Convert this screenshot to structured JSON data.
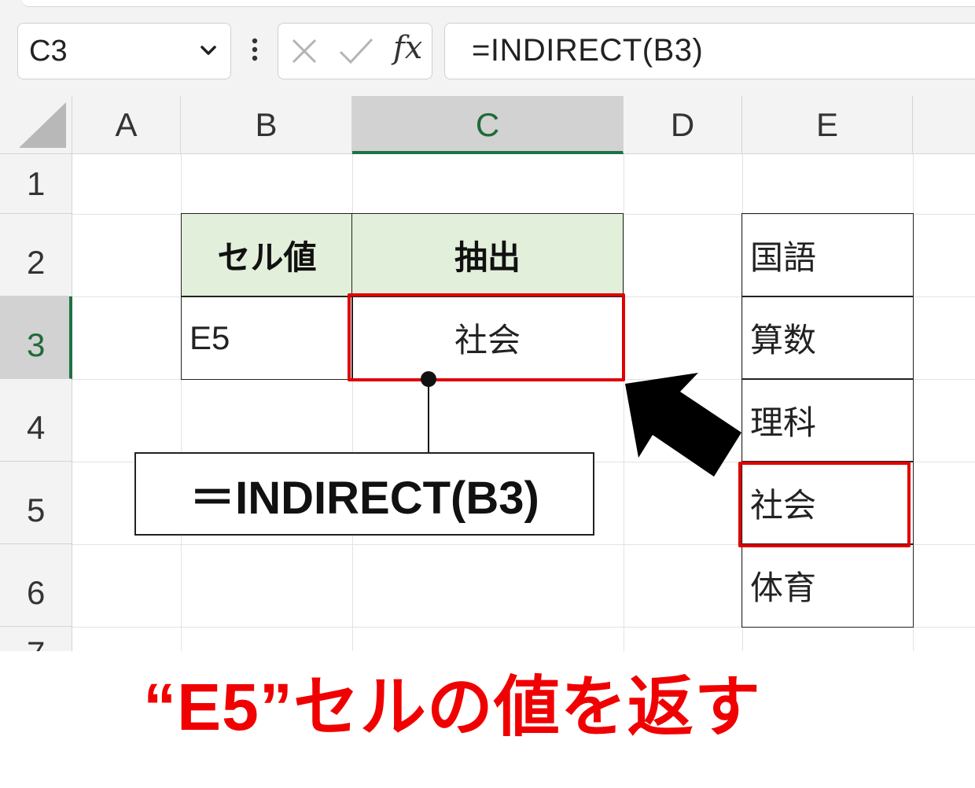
{
  "formula_bar": {
    "name_box_value": "C3",
    "formula": "=INDIRECT(B3)",
    "fx_label": "fx",
    "icons": [
      "chevron-down-icon",
      "vertical-dots-icon",
      "cancel-x-icon",
      "check-icon",
      "fx-icon"
    ]
  },
  "sheet": {
    "columns": [
      "A",
      "B",
      "C",
      "D",
      "E"
    ],
    "rows": [
      "1",
      "2",
      "3",
      "4",
      "5",
      "6",
      "7"
    ],
    "selected_cell": "C3",
    "cells": {
      "B2": "セル値",
      "C2": "抽出",
      "B3": "E5",
      "C3": "社会",
      "E2": "国語",
      "E3": "算数",
      "E4": "理科",
      "E5": "社会",
      "E6": "体育"
    },
    "header_fill": "#e2efda"
  },
  "annotation": {
    "callout_text": "＝INDIRECT(B3)",
    "caption": "“E5”セルの値を返す",
    "highlight_color": "#e00000"
  }
}
